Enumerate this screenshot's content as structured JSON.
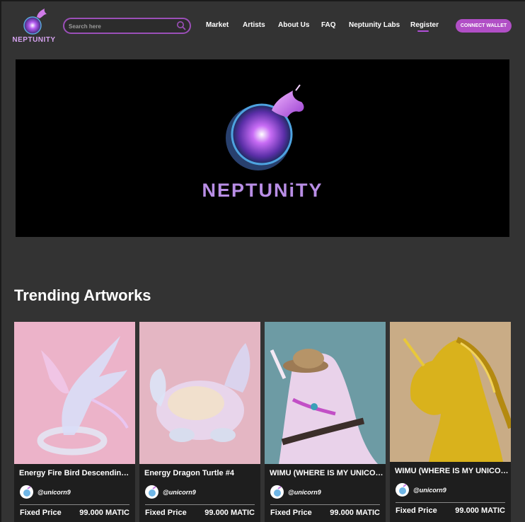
{
  "header": {
    "logo_text": "NEPTUNITY",
    "search_placeholder": "Search here",
    "nav": [
      "Market",
      "Artists",
      "About Us",
      "FAQ",
      "Neptunity Labs",
      "Register"
    ],
    "connect_label": "CONNECT WALLET"
  },
  "banner": {
    "title": "NEPTUNiTY"
  },
  "trending": {
    "title": "Trending Artworks",
    "cards": [
      {
        "title": "Energy Fire Bird Descending in...",
        "creator": "@unicorn9",
        "price_label": "Fixed Price",
        "price": "99.000 MATIC"
      },
      {
        "title": "Energy Dragon Turtle #4",
        "creator": "@unicorn9",
        "price_label": "Fixed Price",
        "price": "99.000 MATIC"
      },
      {
        "title": "WIMU (WHERE IS MY UNICORN)...",
        "creator": "@unicorn9",
        "price_label": "Fixed Price",
        "price": "99.000 MATIC"
      },
      {
        "title": "WIMU (WHERE IS MY UNICORN)...",
        "creator": "@unicorn9",
        "price_label": "Fixed Price",
        "price": "99.000 MATIC"
      }
    ]
  },
  "colors": {
    "accent": "#b14fc6",
    "background": "#333333",
    "card": "#1e1e1e"
  }
}
